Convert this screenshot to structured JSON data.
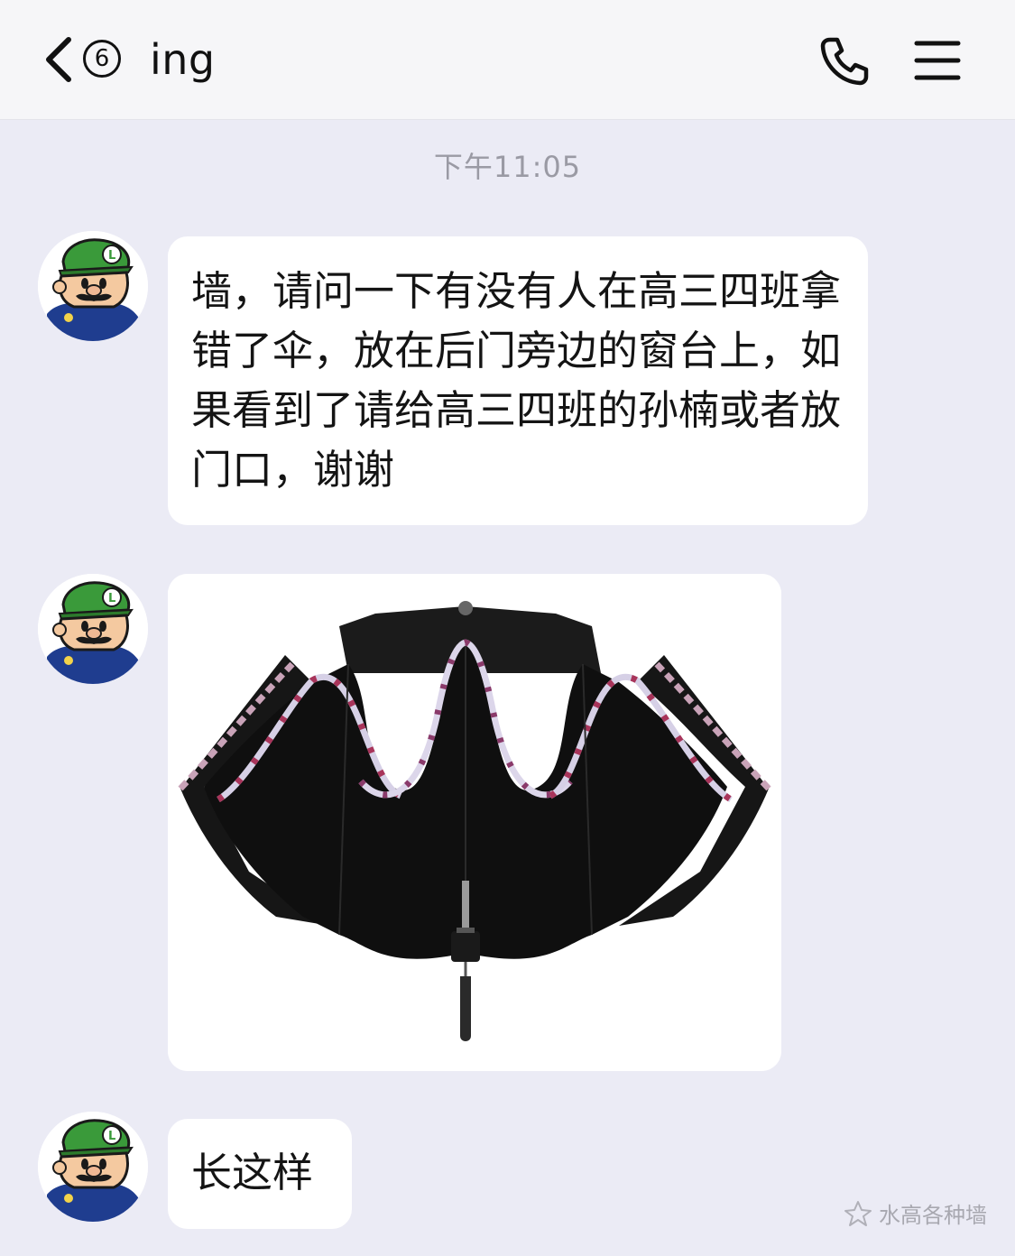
{
  "header": {
    "unread_count": "6",
    "title": "ing",
    "back_icon": "chevron-left-icon",
    "call_icon": "phone-icon",
    "menu_icon": "hamburger-menu-icon"
  },
  "chat": {
    "timestamp": "下午11:05",
    "messages": [
      {
        "type": "text",
        "text": "墙，请问一下有没有人在高三四班拿错了伞，放在后门旁边的窗台上，如果看到了请给高三四班的孙楠或者放门口，谢谢"
      },
      {
        "type": "image",
        "image": "folded-black-umbrella-photo"
      },
      {
        "type": "text",
        "text": "长这样"
      }
    ]
  },
  "watermark": {
    "text": "水高各种墙",
    "icon": "star-logo-icon"
  },
  "colors": {
    "background": "#ebebf5",
    "bubble": "#ffffff",
    "topbar": "#f6f6f8",
    "timestamp": "#9a9aa4"
  }
}
